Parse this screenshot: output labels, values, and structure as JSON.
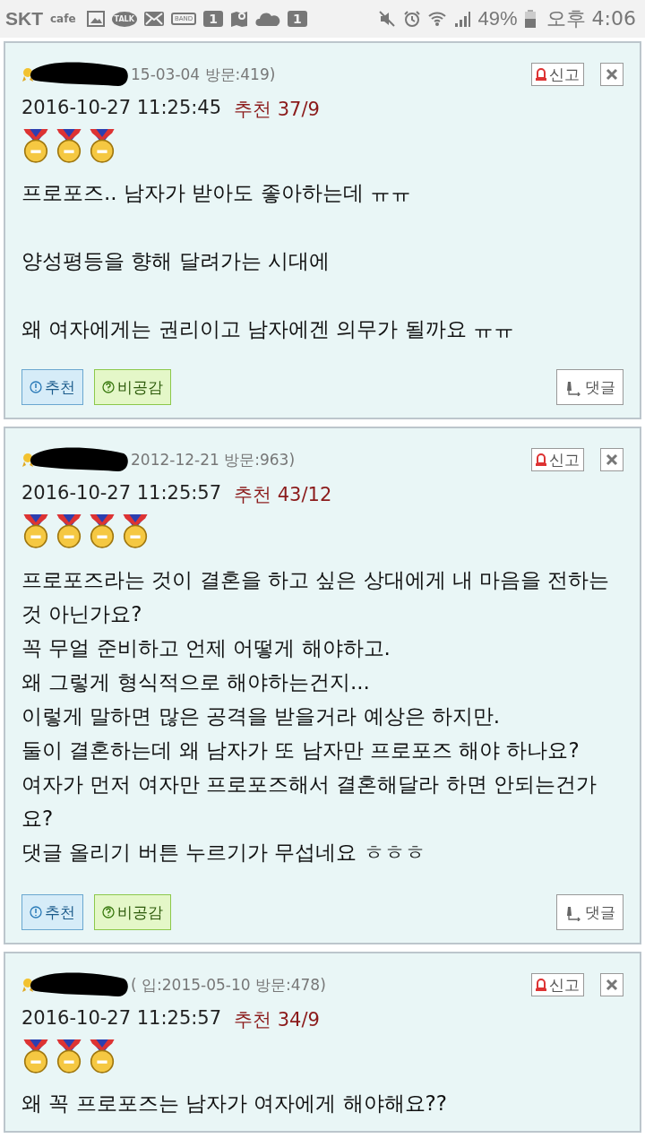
{
  "status_bar": {
    "carrier": "SKT",
    "carrier_sub": "cafe",
    "notifications": [
      {
        "kind": "gallery"
      },
      {
        "kind": "talk",
        "label": "TALK"
      },
      {
        "kind": "mail"
      },
      {
        "kind": "band",
        "label": "BAND"
      },
      {
        "kind": "badge",
        "label": "1"
      },
      {
        "kind": "map"
      },
      {
        "kind": "cloud"
      },
      {
        "kind": "badge",
        "label": "1"
      }
    ],
    "battery": "49%",
    "time": "오후 4:06"
  },
  "comments": [
    {
      "meta": "15-03-04 방문:419)",
      "date": "2016-10-27 11:25:45",
      "votes": "추천 37/9",
      "medals": [
        {
          "kind": "medal"
        },
        {
          "kind": "medal"
        },
        {
          "kind": "medal"
        }
      ],
      "spaced": true,
      "paragraphs": [
        "프로포즈.. 남자가 받아도 좋아하는데 ㅠㅠ",
        "양성평등을 향해 달려가는 시대에",
        "왜 여자에게는 권리이고 남자에겐 의무가 될까요 ㅠㅠ"
      ],
      "report": "신고",
      "recommend": "추천",
      "disagree": "비공감",
      "reply": "댓글"
    },
    {
      "meta": "2012-12-21 방문:963)",
      "date": "2016-10-27 11:25:57",
      "votes": "추천 43/12",
      "medals": [
        {
          "kind": "medal"
        },
        {
          "kind": "medal"
        },
        {
          "kind": "medal"
        },
        {
          "kind": "medal"
        }
      ],
      "spaced": false,
      "paragraphs": [
        "프로포즈라는 것이 결혼을 하고 싶은 상대에게 내 마음을 전하는 것 아닌가요?",
        "꼭 무얼 준비하고 언제 어떻게 해야하고.",
        "왜 그렇게 형식적으로 해야하는건지...",
        "이렇게 말하면 많은 공격을 받을거라 예상은 하지만.",
        "둘이 결혼하는데 왜 남자가  또 남자만 프로포즈 해야 하나요?",
        "여자가 먼저 여자만 프로포즈해서 결혼해달라 하면 안되는건가요?",
        "댓글 올리기 버튼 누르기가 무섭네요 ㅎㅎㅎ"
      ],
      "report": "신고",
      "recommend": "추천",
      "disagree": "비공감",
      "reply": "댓글"
    },
    {
      "meta": "( 입:2015-05-10 방문:478)",
      "date": "2016-10-27 11:25:57",
      "votes": "추천 34/9",
      "medals": [
        {
          "kind": "medal"
        },
        {
          "kind": "medal"
        },
        {
          "kind": "medal"
        }
      ],
      "spaced": true,
      "paragraphs": [
        "왜 꼭 프로포즈는 남자가 여자에게 해야해요??"
      ],
      "report": "신고"
    }
  ]
}
